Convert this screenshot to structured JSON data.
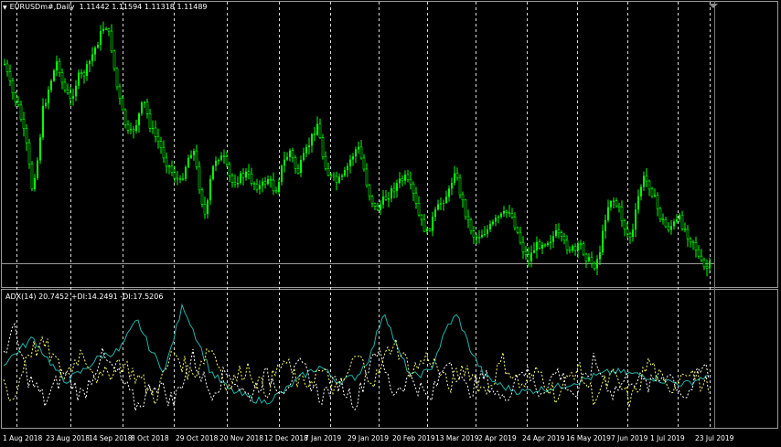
{
  "main_chart": {
    "header_arrow": "▼",
    "symbol_tf": "EURUSDm#,Daily",
    "ohlc": "1.11442 1.11594 1.11318 1.11489"
  },
  "indicator": {
    "header": "ADX(14) 20.7452 +DI:14.2491 -DI:17.5206"
  },
  "x_axis": {
    "labels": [
      "1 Aug 2018",
      "23 Aug 2018",
      "14 Sep 2018",
      "8 Oct 2018",
      "29 Oct 2018",
      "20 Nov 2018",
      "12 Dec 2018",
      "7 Jan 2019",
      "29 Jan 2019",
      "20 Feb 2019",
      "13 Mar 2019",
      "2 Apr 2019",
      "24 Apr 2019",
      "16 May 2019",
      "7 Jun 2019",
      "1 Jul 2019",
      "23 Jul 2019"
    ]
  },
  "colors": {
    "background": "#000000",
    "candles": "#00ff00",
    "grid": "#ffffff",
    "adx": "#20b2aa",
    "plus_di": "#ffffff",
    "minus_di": "#ffff66"
  },
  "chart_data": {
    "type": "candlestick",
    "x": [
      "1 Aug 2018",
      "23 Aug 2018",
      "14 Sep 2018",
      "8 Oct 2018",
      "29 Oct 2018",
      "20 Nov 2018",
      "12 Dec 2018",
      "7 Jan 2019",
      "29 Jan 2019",
      "20 Feb 2019",
      "13 Mar 2019",
      "2 Apr 2019",
      "24 Apr 2019",
      "16 May 2019",
      "7 Jun 2019",
      "1 Jul 2019",
      "23 Jul 2019"
    ],
    "price_close_approx": [
      1.165,
      1.16,
      1.17,
      1.155,
      1.14,
      1.135,
      1.138,
      1.146,
      1.142,
      1.134,
      1.132,
      1.124,
      1.118,
      1.117,
      1.125,
      1.128,
      1.115
    ],
    "last_ohlc": {
      "open": 1.11442,
      "high": 1.11594,
      "low": 1.11318,
      "close": 1.11489
    },
    "indicator": {
      "name": "ADX(14)",
      "adx": 20.7452,
      "plus_di": 14.2491,
      "minus_di": 17.5206,
      "adx_peaks": [
        {
          "date": "29 Oct 2018",
          "value": 48
        },
        {
          "date": "20 Feb 2019",
          "value": 46
        },
        {
          "date": "13 Mar 2019",
          "value": 44
        }
      ]
    }
  }
}
